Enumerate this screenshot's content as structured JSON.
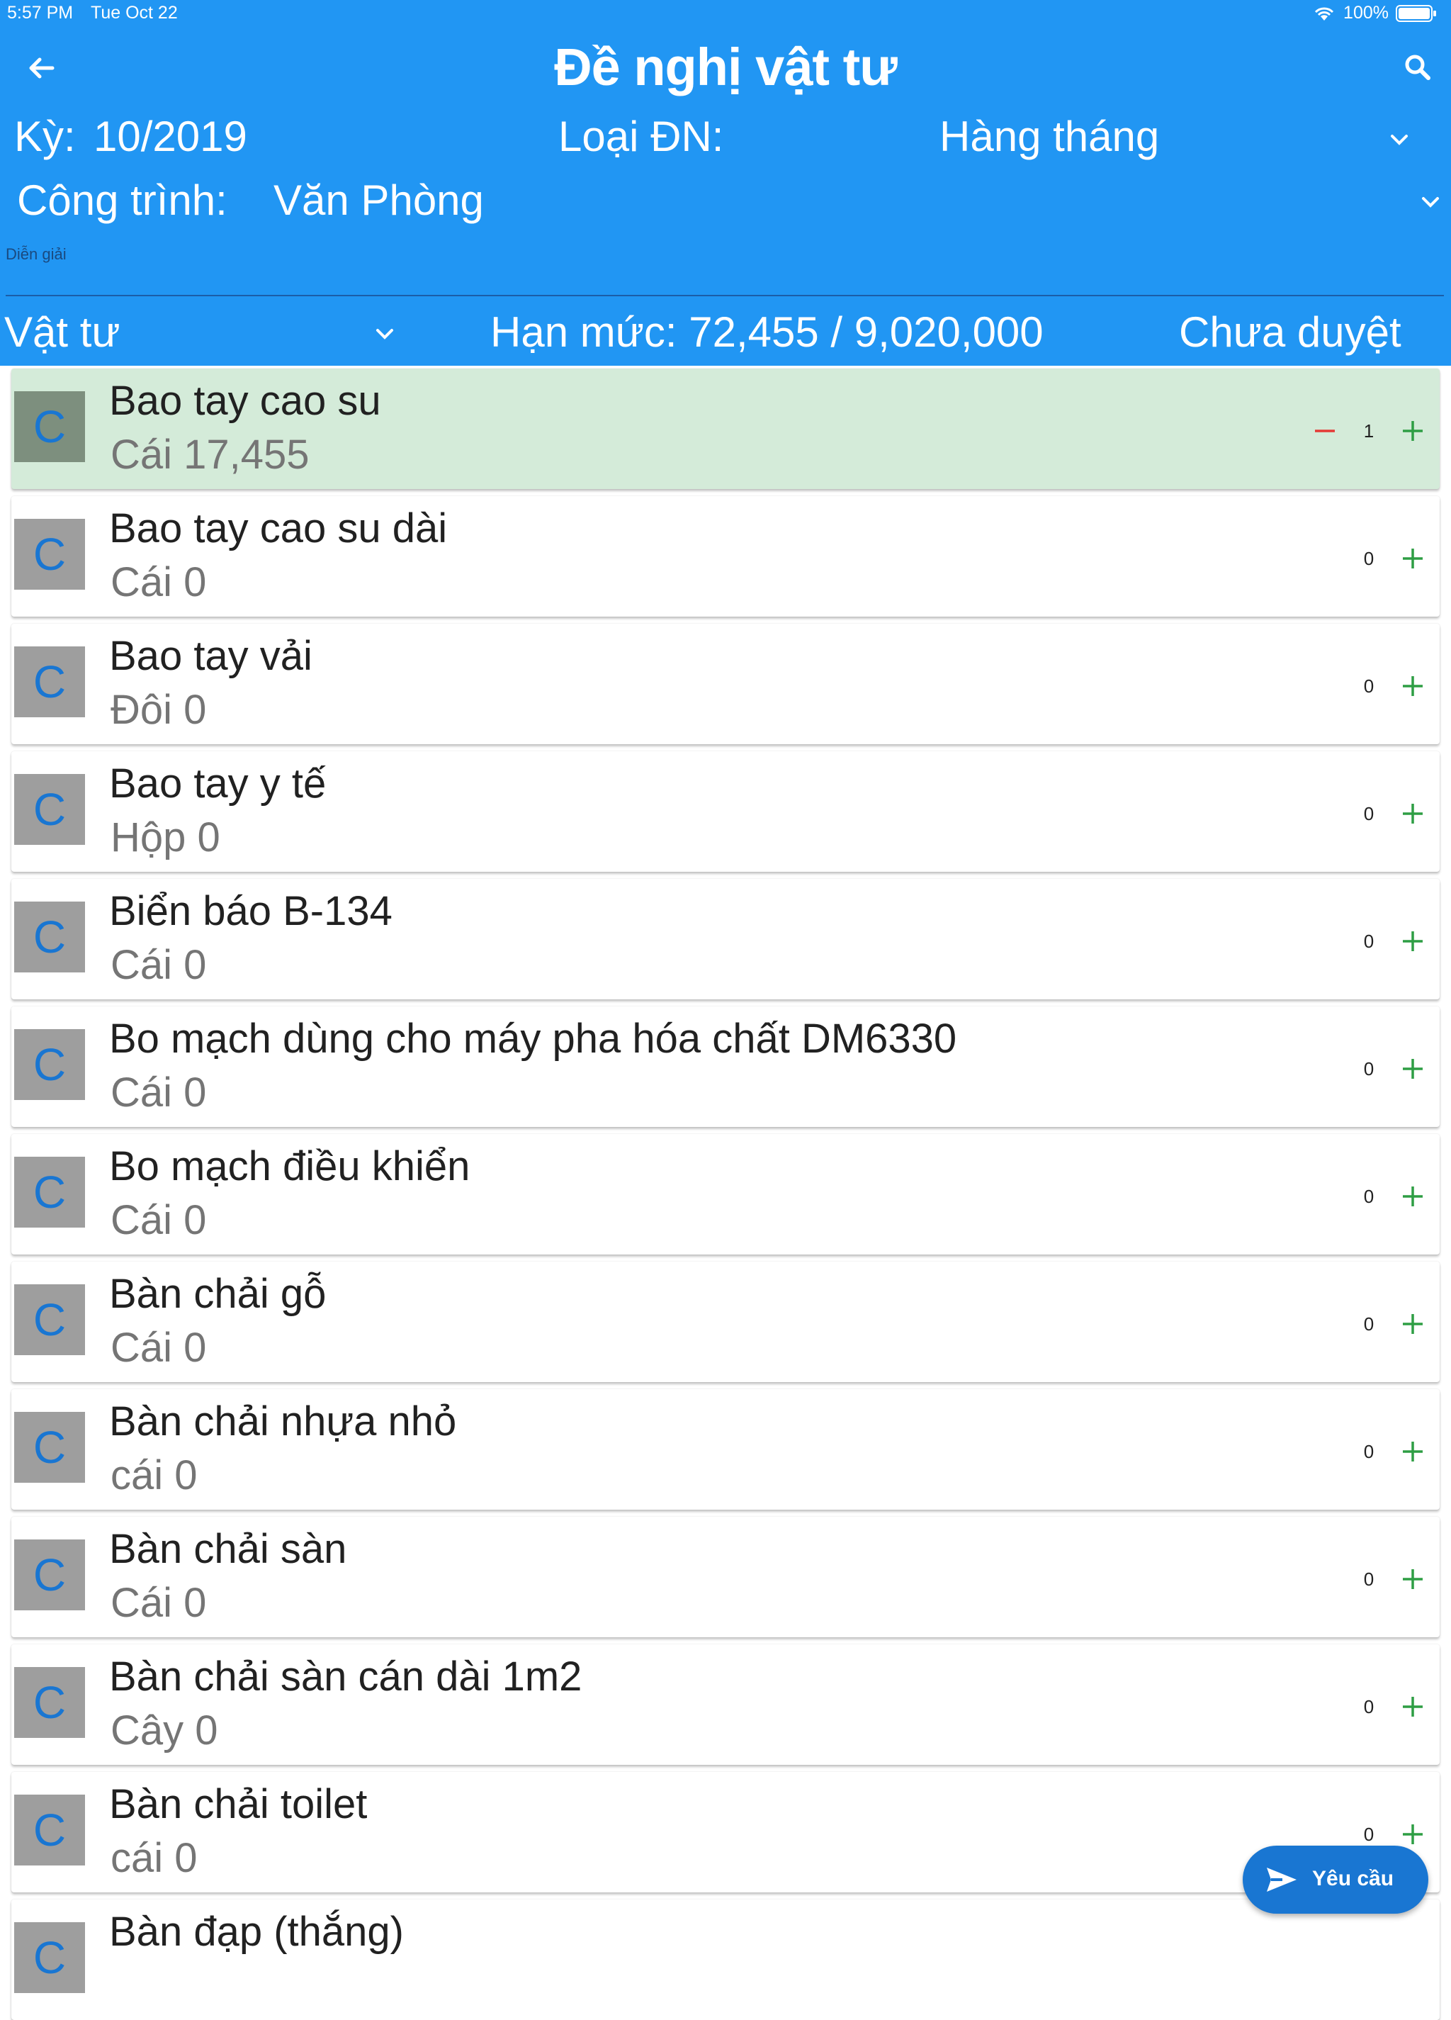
{
  "status_bar": {
    "time": "5:57 PM",
    "date": "Tue Oct 22",
    "battery": "100%"
  },
  "header": {
    "title": "Đề nghị vật tư",
    "ky_label": "Kỳ:",
    "ky_value": "10/2019",
    "loai_label": "Loại ĐN:",
    "loai_value": "Hàng tháng",
    "cong_trinh_label": "Công trình:",
    "cong_trinh_value": "Văn Phòng",
    "dien_giai_placeholder": "Diễn giải",
    "category": "Vật tư",
    "han_muc": "Hạn mức: 72,455 / 9,020,000",
    "status": "Chưa duyệt"
  },
  "items": [
    {
      "avatar": "C",
      "name": "Bao tay cao su",
      "sub": "Cái 17,455",
      "qty": "1",
      "selected": true
    },
    {
      "avatar": "C",
      "name": "Bao tay cao su dài",
      "sub": "Cái 0",
      "qty": "0"
    },
    {
      "avatar": "C",
      "name": "Bao tay vải",
      "sub": "Đôi 0",
      "qty": "0"
    },
    {
      "avatar": "C",
      "name": "Bao tay y tế",
      "sub": "Hộp 0",
      "qty": "0"
    },
    {
      "avatar": "C",
      "name": "Biển báo B-134",
      "sub": "Cái 0",
      "qty": "0"
    },
    {
      "avatar": "C",
      "name": "Bo mạch dùng cho máy pha hóa chất DM6330",
      "sub": "Cái 0",
      "qty": "0"
    },
    {
      "avatar": "C",
      "name": "Bo mạch điều khiển",
      "sub": "Cái 0",
      "qty": "0"
    },
    {
      "avatar": "C",
      "name": "Bàn chải gỗ",
      "sub": "Cái 0",
      "qty": "0"
    },
    {
      "avatar": "C",
      "name": "Bàn chải nhựa nhỏ",
      "sub": "cái 0",
      "qty": "0"
    },
    {
      "avatar": "C",
      "name": "Bàn chải sàn",
      "sub": "Cái 0",
      "qty": "0"
    },
    {
      "avatar": "C",
      "name": "Bàn chải sàn cán dài 1m2",
      "sub": "Cây 0",
      "qty": "0"
    },
    {
      "avatar": "C",
      "name": "Bàn chải toilet",
      "sub": "cái 0",
      "qty": "0"
    },
    {
      "avatar": "C",
      "name": "Bàn đạp (thắng)",
      "sub": "",
      "qty": ""
    }
  ],
  "fab": {
    "label": "Yêu cầu"
  },
  "colors": {
    "header": "#2196f3",
    "selected_row": "#d4ebd9",
    "plus": "#2e9e44",
    "minus": "#e53935",
    "fab": "#1976d2"
  }
}
